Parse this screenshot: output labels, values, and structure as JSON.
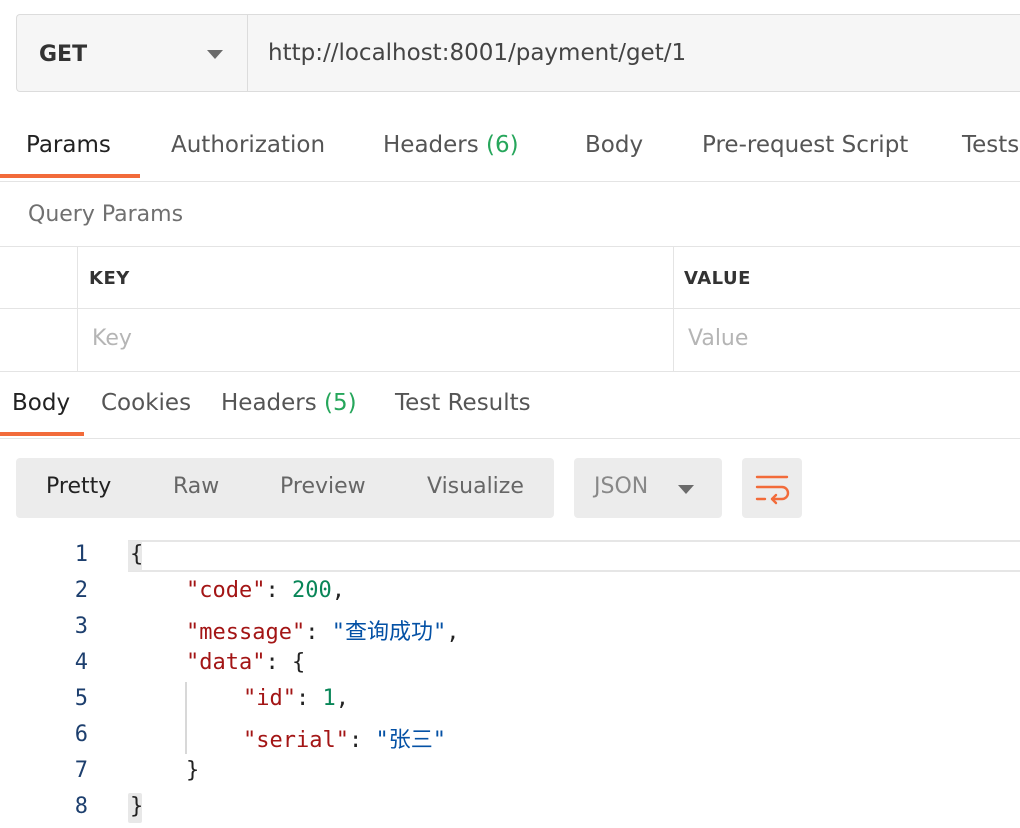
{
  "request": {
    "method": "GET",
    "url": "http://localhost:8001/payment/get/1"
  },
  "request_tabs": {
    "params": "Params",
    "authorization": "Authorization",
    "headers": "Headers",
    "headers_count": "(6)",
    "body": "Body",
    "prerequest": "Pre-request Script",
    "tests": "Tests"
  },
  "query_params": {
    "title": "Query Params",
    "key_header": "KEY",
    "value_header": "VALUE",
    "key_placeholder": "Key",
    "value_placeholder": "Value"
  },
  "response_tabs": {
    "body": "Body",
    "cookies": "Cookies",
    "headers": "Headers",
    "headers_count": "(5)",
    "test_results": "Test Results"
  },
  "view": {
    "pretty": "Pretty",
    "raw": "Raw",
    "preview": "Preview",
    "visualize": "Visualize",
    "format": "JSON"
  },
  "code": {
    "line_numbers": [
      "1",
      "2",
      "3",
      "4",
      "5",
      "6",
      "7",
      "8"
    ],
    "l1": "{",
    "l2_key": "\"code\"",
    "l2_sep": ": ",
    "l2_val": "200",
    "l2_end": ",",
    "l3_key": "\"message\"",
    "l3_sep": ": ",
    "l3_val": "\"查询成功\"",
    "l3_end": ",",
    "l4_key": "\"data\"",
    "l4_sep": ": {",
    "l5_key": "\"id\"",
    "l5_sep": ": ",
    "l5_val": "1",
    "l5_end": ",",
    "l6_key": "\"serial\"",
    "l6_sep": ": ",
    "l6_val": "\"张三\"",
    "l7": "}",
    "l8": "}"
  },
  "colors": {
    "accent": "#f26b3a",
    "count_green": "#26a65b"
  }
}
